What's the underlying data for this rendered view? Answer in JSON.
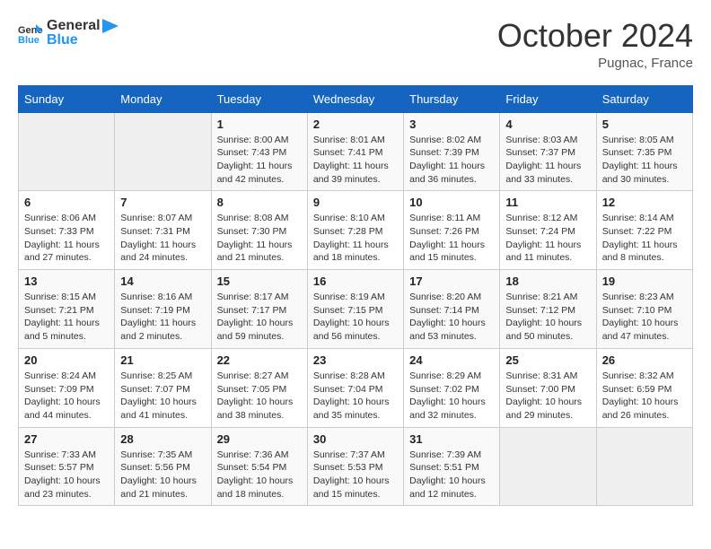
{
  "header": {
    "logo_general": "General",
    "logo_blue": "Blue",
    "month_title": "October 2024",
    "location": "Pugnac, France"
  },
  "weekdays": [
    "Sunday",
    "Monday",
    "Tuesday",
    "Wednesday",
    "Thursday",
    "Friday",
    "Saturday"
  ],
  "weeks": [
    [
      null,
      null,
      {
        "day": 1,
        "sunrise": "8:00 AM",
        "sunset": "7:43 PM",
        "daylight": "11 hours and 42 minutes."
      },
      {
        "day": 2,
        "sunrise": "8:01 AM",
        "sunset": "7:41 PM",
        "daylight": "11 hours and 39 minutes."
      },
      {
        "day": 3,
        "sunrise": "8:02 AM",
        "sunset": "7:39 PM",
        "daylight": "11 hours and 36 minutes."
      },
      {
        "day": 4,
        "sunrise": "8:03 AM",
        "sunset": "7:37 PM",
        "daylight": "11 hours and 33 minutes."
      },
      {
        "day": 5,
        "sunrise": "8:05 AM",
        "sunset": "7:35 PM",
        "daylight": "11 hours and 30 minutes."
      }
    ],
    [
      {
        "day": 6,
        "sunrise": "8:06 AM",
        "sunset": "7:33 PM",
        "daylight": "11 hours and 27 minutes."
      },
      {
        "day": 7,
        "sunrise": "8:07 AM",
        "sunset": "7:31 PM",
        "daylight": "11 hours and 24 minutes."
      },
      {
        "day": 8,
        "sunrise": "8:08 AM",
        "sunset": "7:30 PM",
        "daylight": "11 hours and 21 minutes."
      },
      {
        "day": 9,
        "sunrise": "8:10 AM",
        "sunset": "7:28 PM",
        "daylight": "11 hours and 18 minutes."
      },
      {
        "day": 10,
        "sunrise": "8:11 AM",
        "sunset": "7:26 PM",
        "daylight": "11 hours and 15 minutes."
      },
      {
        "day": 11,
        "sunrise": "8:12 AM",
        "sunset": "7:24 PM",
        "daylight": "11 hours and 11 minutes."
      },
      {
        "day": 12,
        "sunrise": "8:14 AM",
        "sunset": "7:22 PM",
        "daylight": "11 hours and 8 minutes."
      }
    ],
    [
      {
        "day": 13,
        "sunrise": "8:15 AM",
        "sunset": "7:21 PM",
        "daylight": "11 hours and 5 minutes."
      },
      {
        "day": 14,
        "sunrise": "8:16 AM",
        "sunset": "7:19 PM",
        "daylight": "11 hours and 2 minutes."
      },
      {
        "day": 15,
        "sunrise": "8:17 AM",
        "sunset": "7:17 PM",
        "daylight": "10 hours and 59 minutes."
      },
      {
        "day": 16,
        "sunrise": "8:19 AM",
        "sunset": "7:15 PM",
        "daylight": "10 hours and 56 minutes."
      },
      {
        "day": 17,
        "sunrise": "8:20 AM",
        "sunset": "7:14 PM",
        "daylight": "10 hours and 53 minutes."
      },
      {
        "day": 18,
        "sunrise": "8:21 AM",
        "sunset": "7:12 PM",
        "daylight": "10 hours and 50 minutes."
      },
      {
        "day": 19,
        "sunrise": "8:23 AM",
        "sunset": "7:10 PM",
        "daylight": "10 hours and 47 minutes."
      }
    ],
    [
      {
        "day": 20,
        "sunrise": "8:24 AM",
        "sunset": "7:09 PM",
        "daylight": "10 hours and 44 minutes."
      },
      {
        "day": 21,
        "sunrise": "8:25 AM",
        "sunset": "7:07 PM",
        "daylight": "10 hours and 41 minutes."
      },
      {
        "day": 22,
        "sunrise": "8:27 AM",
        "sunset": "7:05 PM",
        "daylight": "10 hours and 38 minutes."
      },
      {
        "day": 23,
        "sunrise": "8:28 AM",
        "sunset": "7:04 PM",
        "daylight": "10 hours and 35 minutes."
      },
      {
        "day": 24,
        "sunrise": "8:29 AM",
        "sunset": "7:02 PM",
        "daylight": "10 hours and 32 minutes."
      },
      {
        "day": 25,
        "sunrise": "8:31 AM",
        "sunset": "7:00 PM",
        "daylight": "10 hours and 29 minutes."
      },
      {
        "day": 26,
        "sunrise": "8:32 AM",
        "sunset": "6:59 PM",
        "daylight": "10 hours and 26 minutes."
      }
    ],
    [
      {
        "day": 27,
        "sunrise": "7:33 AM",
        "sunset": "5:57 PM",
        "daylight": "10 hours and 23 minutes."
      },
      {
        "day": 28,
        "sunrise": "7:35 AM",
        "sunset": "5:56 PM",
        "daylight": "10 hours and 21 minutes."
      },
      {
        "day": 29,
        "sunrise": "7:36 AM",
        "sunset": "5:54 PM",
        "daylight": "10 hours and 18 minutes."
      },
      {
        "day": 30,
        "sunrise": "7:37 AM",
        "sunset": "5:53 PM",
        "daylight": "10 hours and 15 minutes."
      },
      {
        "day": 31,
        "sunrise": "7:39 AM",
        "sunset": "5:51 PM",
        "daylight": "10 hours and 12 minutes."
      },
      null,
      null
    ]
  ],
  "labels": {
    "sunrise": "Sunrise:",
    "sunset": "Sunset:",
    "daylight": "Daylight:"
  }
}
